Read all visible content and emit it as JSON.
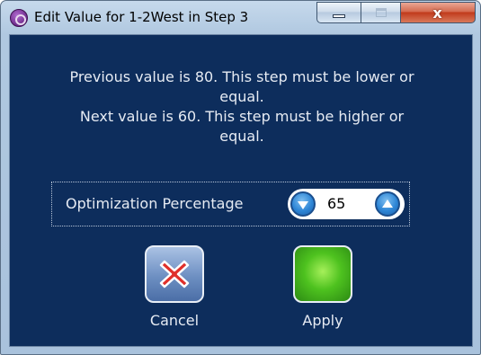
{
  "window": {
    "title": "Edit Value for 1-2West in Step 3",
    "close_glyph": "x",
    "icons": {
      "app": "app-logo-icon",
      "minimize": "minimize-icon",
      "maximize": "maximize-icon",
      "close": "close-icon"
    }
  },
  "message": {
    "line1": "Previous value is 80. This step must be lower or",
    "line2": "equal.",
    "line3": "Next value is 60. This step must be higher or",
    "line4": "equal."
  },
  "setting": {
    "label": "Optimization Percentage",
    "value": "65",
    "icons": {
      "decrement": "chevron-down-icon",
      "increment": "chevron-up-icon"
    }
  },
  "actions": {
    "cancel_label": "Cancel",
    "apply_label": "Apply",
    "icons": {
      "cancel": "red-x-icon",
      "apply": "green-square-icon"
    }
  },
  "colors": {
    "client_background": "#0d2d5c",
    "text": "#e6ebf3",
    "close_button": "#c13a1b",
    "stepper_button": "#2e86d6",
    "apply_green": "#4ec21f",
    "cancel_red": "#e0302a"
  }
}
